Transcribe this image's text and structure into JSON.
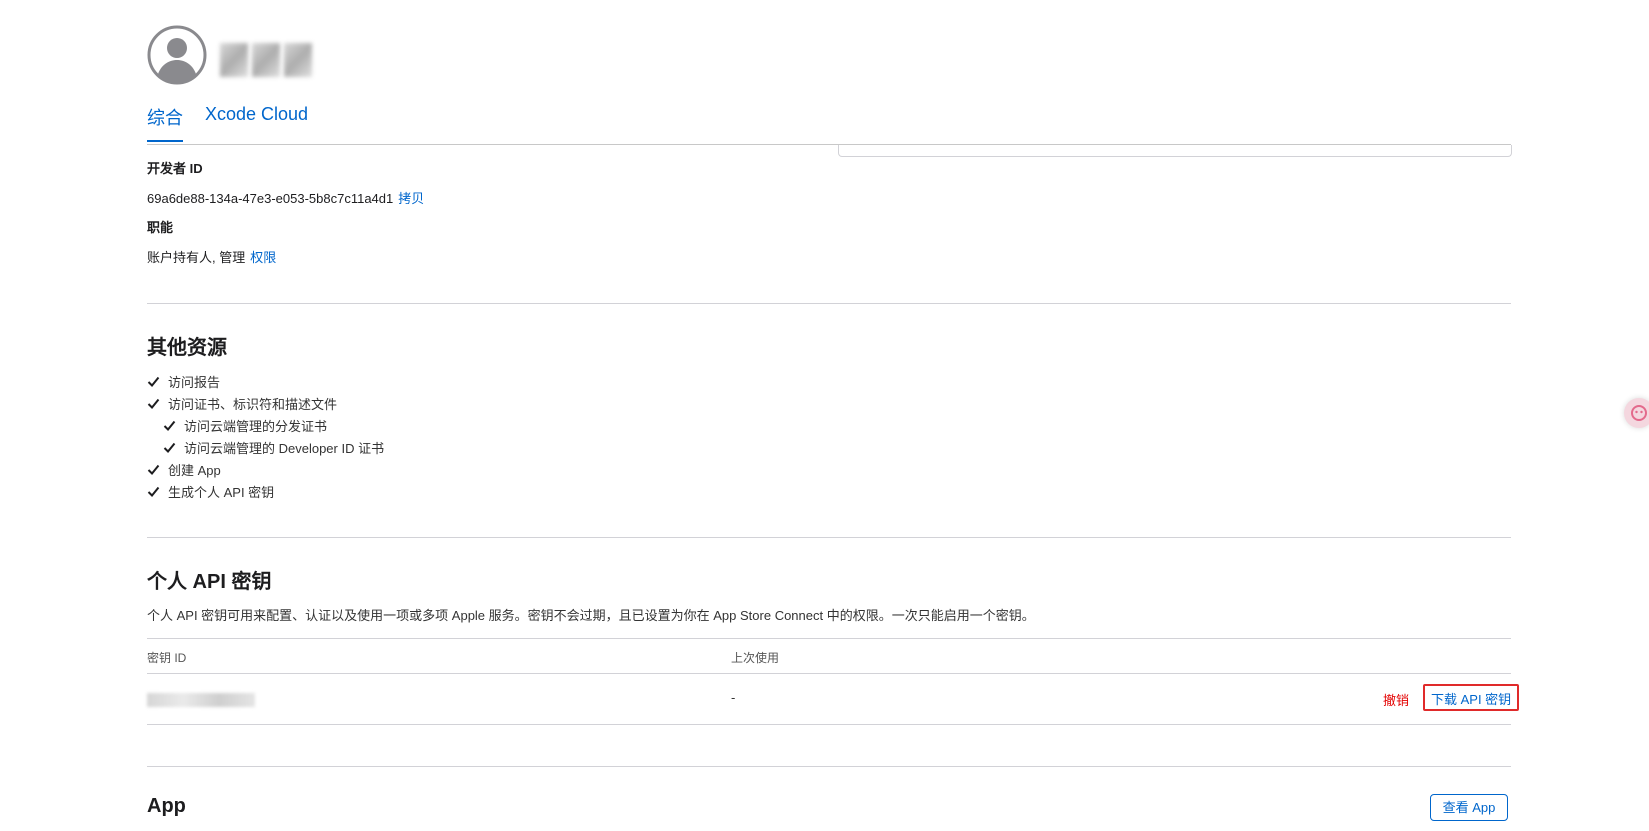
{
  "tabs": [
    {
      "label": "综合",
      "active": true
    },
    {
      "label": "Xcode Cloud",
      "active": false
    }
  ],
  "developer": {
    "id_label": "开发者 ID",
    "id_value": "69a6de88-134a-47e3-e053-5b8c7c11a4d1",
    "copy_label": "拷贝",
    "role_label": "职能",
    "role_value": "账户持有人, 管理",
    "permissions_link": "权限"
  },
  "resources": {
    "title": "其他资源",
    "items": [
      {
        "label": "访问报告",
        "level": 0
      },
      {
        "label": "访问证书、标识符和描述文件",
        "level": 0
      },
      {
        "label": "访问云端管理的分发证书",
        "level": 1
      },
      {
        "label": "访问云端管理的 Developer ID 证书",
        "level": 1
      },
      {
        "label": "创建 App",
        "level": 0
      },
      {
        "label": "生成个人 API 密钥",
        "level": 0
      }
    ]
  },
  "api_keys": {
    "title": "个人 API 密钥",
    "description": "个人 API 密钥可用来配置、认证以及使用一项或多项 Apple 服务。密钥不会过期，且已设置为你在 App Store Connect 中的权限。一次只能启用一个密钥。",
    "columns": [
      "密钥 ID",
      "上次使用"
    ],
    "row": {
      "last_used": "-"
    },
    "revoke_label": "撤销",
    "download_label": "下载 API 密钥"
  },
  "app_section": {
    "title": "App",
    "view_button": "查看 App"
  },
  "icons": {
    "avatar": "user-avatar-icon",
    "check": "checkmark-icon",
    "floating": "assistant-widget-icon"
  },
  "colors": {
    "link": "#0066cc",
    "danger": "#e30000",
    "highlight_border": "#e02a2a"
  }
}
